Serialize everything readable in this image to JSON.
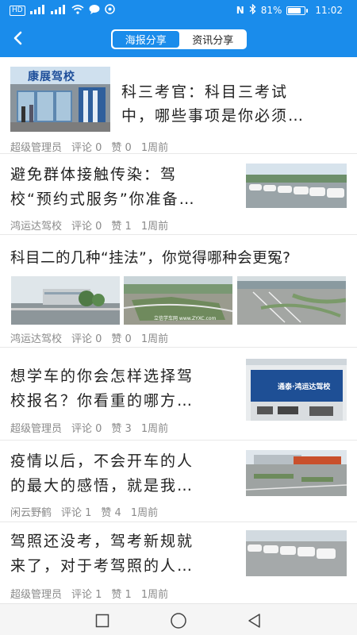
{
  "status_bar": {
    "left_badge": "HD",
    "signal1": "⁴⁶ᶦₗₗ",
    "signal2": "⁴ᴳᶦₗₗ",
    "nfc": "N",
    "battery_text": "81%",
    "battery_level": 0.81,
    "time": "11:02"
  },
  "header": {
    "tabs": [
      {
        "label": "海报分享",
        "active": true
      },
      {
        "label": "资讯分享",
        "active": false
      }
    ]
  },
  "articles": [
    {
      "title_line1": "科三考官：科目三考试",
      "title_line2": "中，哪些事项是你必须…",
      "author": "超级管理员",
      "comments": "评论 0",
      "likes": "赞 0",
      "time": "1周前",
      "thumb_text": "康展驾校"
    },
    {
      "title_line1": "避免群体接触传染：驾",
      "title_line2": "校“预约式服务”你准备…",
      "author": "鸿运达驾校",
      "comments": "评论 0",
      "likes": "赞 1",
      "time": "1周前"
    },
    {
      "title_line1": "科目二的几种“挂法”，你觉得哪种会更冤?",
      "author": "鸿运达驾校",
      "comments": "评论 0",
      "likes": "赞 0",
      "time": "1周前",
      "thumb2_text": "立信学车网 www.ZYXC.com"
    },
    {
      "title_line1": "想学车的你会怎样选择驾",
      "title_line2": "校报名？你看重的哪方…",
      "author": "超级管理员",
      "comments": "评论 0",
      "likes": "赞 3",
      "time": "1周前",
      "thumb_text": "通泰·鸿运达驾校"
    },
    {
      "title_line1": "疫情以后，不会开车的人",
      "title_line2": "的最大的感悟，就是我…",
      "author": "闲云野鹤",
      "comments": "评论 1",
      "likes": "赞 4",
      "time": "1周前"
    },
    {
      "title_line1": "驾照还没考，驾考新规就",
      "title_line2": "来了，对于考驾照的人…",
      "author": "超级管理员",
      "comments": "评论 1",
      "likes": "赞 1",
      "time": "1周前"
    }
  ],
  "colors": {
    "accent": "#1a8ceb",
    "meta": "#8a8a8a",
    "divider": "#e8e8e8"
  },
  "icons": {
    "back": "chevron-left-icon",
    "nav_recent": "square-icon",
    "nav_home": "circle-icon",
    "nav_back": "triangle-left-icon"
  }
}
